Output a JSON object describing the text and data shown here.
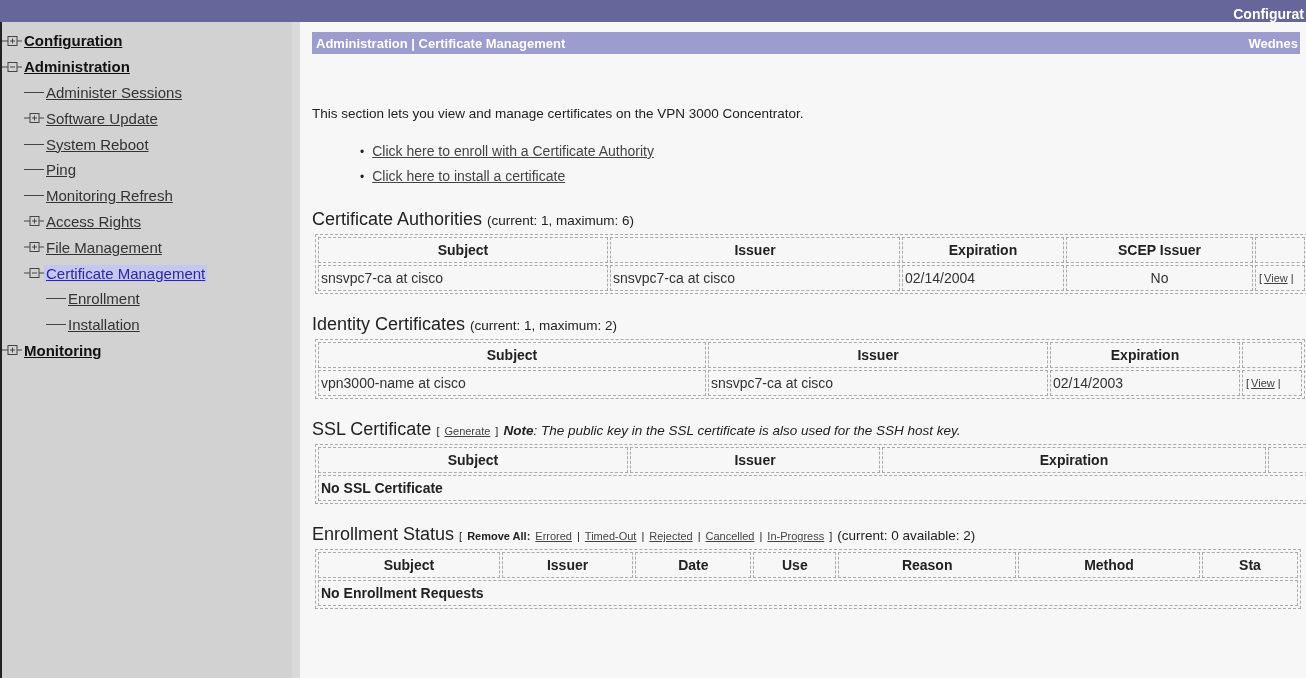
{
  "top_bar": {
    "title": "Configurat"
  },
  "sidebar": {
    "items": [
      {
        "label": "Configuration",
        "expanded": false,
        "selected": false
      },
      {
        "label": "Administration",
        "expanded": true,
        "selected": false,
        "children": [
          {
            "label": "Administer Sessions",
            "selected": false
          },
          {
            "label": "Software Update",
            "expanded": false,
            "selected": false
          },
          {
            "label": "System Reboot",
            "selected": false
          },
          {
            "label": "Ping",
            "selected": false
          },
          {
            "label": "Monitoring Refresh",
            "selected": false
          },
          {
            "label": "Access Rights",
            "expanded": false,
            "selected": false
          },
          {
            "label": "File Management",
            "expanded": false,
            "selected": false
          },
          {
            "label": "Certificate Management",
            "expanded": true,
            "selected": true,
            "children": [
              {
                "label": "Enrollment",
                "selected": false
              },
              {
                "label": "Installation",
                "selected": false
              }
            ]
          }
        ]
      },
      {
        "label": "Monitoring",
        "expanded": false,
        "selected": false
      }
    ]
  },
  "breadcrumb": {
    "path": "Administration | Certificate Management",
    "date": "Wednes"
  },
  "intro": "This section lets you view and manage certificates on the VPN 3000 Concentrator.",
  "links": [
    {
      "bullet": "•",
      "text": "Click here to enroll with a Certificate Authority"
    },
    {
      "bullet": "•",
      "text": "Click here to install a certificate"
    }
  ],
  "sections": [
    {
      "title": "Certificate Authorities",
      "parts": [
        {
          "kind": "text",
          "text": "(current: 1, maximum: 6)"
        }
      ],
      "columns": [
        "Subject",
        "Issuer",
        "Expiration",
        "SCEP Issuer"
      ],
      "rows": [
        {
          "kind": "data",
          "cells": [
            "snsvpc7-ca at cisco",
            "snsvpc7-ca at cisco",
            "02/14/2004",
            "No"
          ],
          "action": {
            "open": "[",
            "link": "View",
            "close": "|"
          }
        }
      ]
    },
    {
      "title": "Identity Certificates",
      "parts": [
        {
          "kind": "text",
          "text": "(current: 1, maximum: 2)"
        }
      ],
      "columns": [
        "Subject",
        "Issuer",
        "Expiration"
      ],
      "rows": [
        {
          "kind": "data",
          "cells": [
            "vpn3000-name at cisco",
            "snsvpc7-ca at cisco",
            "02/14/2003"
          ],
          "action": {
            "open": "[",
            "link": "View",
            "close": "|"
          }
        }
      ]
    },
    {
      "title": "SSL Certificate",
      "parts": [
        {
          "kind": "bracket",
          "text": "["
        },
        {
          "kind": "link",
          "text": "Generate"
        },
        {
          "kind": "bracket",
          "text": "]"
        },
        {
          "kind": "note",
          "text": "**Note**: The public key in the SSL certificate is also used for the SSH host key."
        }
      ],
      "columns": [
        "Subject",
        "Issuer",
        "Expiration"
      ],
      "rows": [
        {
          "kind": "empty",
          "text": "No SSL Certificate"
        }
      ]
    },
    {
      "title": "Enrollment Status",
      "parts": [
        {
          "kind": "bracket",
          "text": "["
        },
        {
          "kind": "label",
          "text": "Remove All:"
        },
        {
          "kind": "link",
          "text": "Errored"
        },
        {
          "kind": "separator",
          "text": "|"
        },
        {
          "kind": "link",
          "text": "Timed-Out"
        },
        {
          "kind": "separator",
          "text": "|"
        },
        {
          "kind": "link",
          "text": "Rejected"
        },
        {
          "kind": "separator",
          "text": "|"
        },
        {
          "kind": "link",
          "text": "Cancelled"
        },
        {
          "kind": "separator",
          "text": "|"
        },
        {
          "kind": "link",
          "text": "In-Progress"
        },
        {
          "kind": "bracket",
          "text": "]"
        },
        {
          "kind": "text",
          "text": "(current: 0 available: 2)"
        }
      ],
      "columns": [
        "Subject",
        "Issuer",
        "Date",
        "Use",
        "Reason",
        "Method",
        "Sta"
      ],
      "rows": [
        {
          "kind": "empty",
          "text": "No Enrollment Requests"
        }
      ]
    }
  ]
}
